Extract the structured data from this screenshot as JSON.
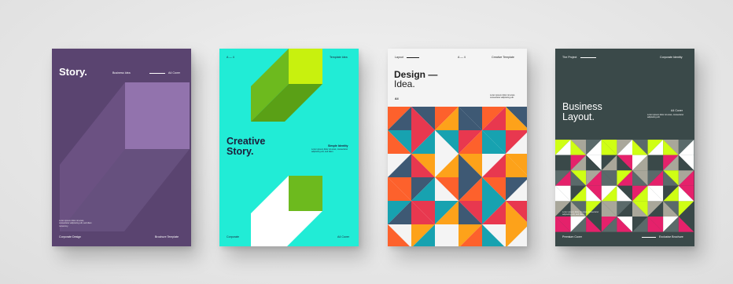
{
  "cards": [
    {
      "title": "Story.",
      "header_mid": "Business Idea",
      "header_right": "A4 Cover",
      "body": "Lorem ipsum dolor sit amet, consectetur adipiscing elit, sed diam nonummy.",
      "footer_left": "Corporate Design",
      "footer_right": "Brochure Template",
      "colors": {
        "bg": "#5a4470",
        "shape_light": "#9273ad",
        "shape_dark": "#6b5183"
      }
    },
    {
      "header_left": "A — 4",
      "header_right": "Template Idea",
      "title_line1": "Creative",
      "title_line2": "Story.",
      "side_title": "Simple Identity",
      "side_body": "Lorem ipsum dolor sit amet, consectetur adipiscing elit, sed diam.",
      "footer_left": "Corporate",
      "footer_right": "A4 Cover",
      "colors": {
        "bg": "#21ecd6",
        "lime": "#c8f10e",
        "green": "#5aa016",
        "green_light": "#6dba1e"
      }
    },
    {
      "header_left": "Layout",
      "header_mid": "A — 4",
      "header_right": "Creative Template",
      "title_line1": "Design —",
      "title_line2": "Idea.",
      "size_label": "A4",
      "side_body": "Lorem ipsum dolor sit amet, consectetur adipiscing elit.",
      "colors": {
        "red": "#e8384f",
        "orange": "#fd612c",
        "amber": "#fda21a",
        "teal": "#17a2b0",
        "slate": "#3e5974",
        "white": "#f4f4f4"
      }
    },
    {
      "header_left": "The Project",
      "header_right": "Corporate Identity",
      "title_line1": "Business",
      "title_line2": "Layout.",
      "side_title": "A4 Cover",
      "side_body": "Lorem ipsum dolor sit amet, consectetur adipiscing elit.",
      "body": "Lorem ipsum dolor sit amet, consectetur adipiscing elit, sed diam.",
      "footer_left": "Premium Cover",
      "footer_right": "Exclusive Brochure",
      "colors": {
        "bg": "#3a4949",
        "lime": "#cfff14",
        "magenta": "#e5216b",
        "sand": "#a9a79a",
        "white": "#ffffff",
        "gray": "#5a6a6a"
      }
    }
  ]
}
